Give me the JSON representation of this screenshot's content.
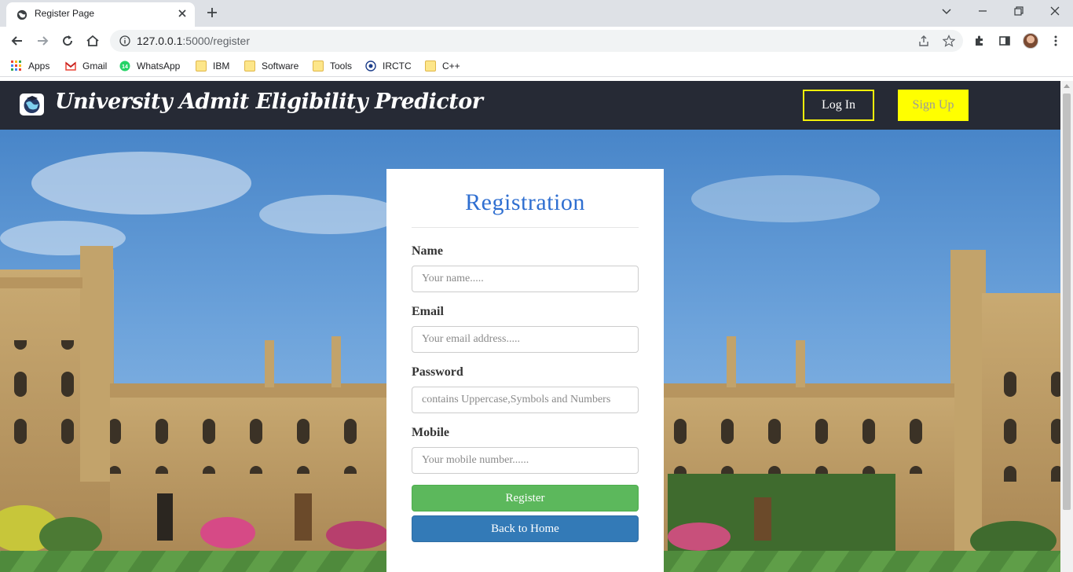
{
  "browser": {
    "tab_title": "Register Page",
    "url_host": "127.0.0.1",
    "url_path": ":5000/register",
    "bookmarks": [
      {
        "label": "Apps",
        "icon": "apps-grid-icon"
      },
      {
        "label": "Gmail",
        "icon": "gmail-icon"
      },
      {
        "label": "WhatsApp",
        "icon": "whatsapp-icon",
        "badge": "14"
      },
      {
        "label": "IBM",
        "icon": "folder-icon"
      },
      {
        "label": "Software",
        "icon": "folder-icon"
      },
      {
        "label": "Tools",
        "icon": "folder-icon"
      },
      {
        "label": "IRCTC",
        "icon": "irctc-icon"
      },
      {
        "label": "C++",
        "icon": "folder-icon"
      }
    ]
  },
  "navbar": {
    "brand": "University Admit Eligibility Predictor",
    "login_label": "Log In",
    "signup_label": "Sign Up"
  },
  "form": {
    "heading": "Registration",
    "name_label": "Name",
    "name_placeholder": "Your name.....",
    "email_label": "Email",
    "email_placeholder": "Your email address.....",
    "password_label": "Password",
    "password_placeholder": "contains Uppercase,Symbols and Numbers",
    "mobile_label": "Mobile",
    "mobile_placeholder": "Your mobile number......",
    "register_label": "Register",
    "home_label": "Back to Home"
  },
  "colors": {
    "navbar_bg": "#262a35",
    "accent_yellow": "#ffff00",
    "heading_blue": "#2f6fd1",
    "register_green": "#5cb85c",
    "home_blue": "#337ab7"
  }
}
